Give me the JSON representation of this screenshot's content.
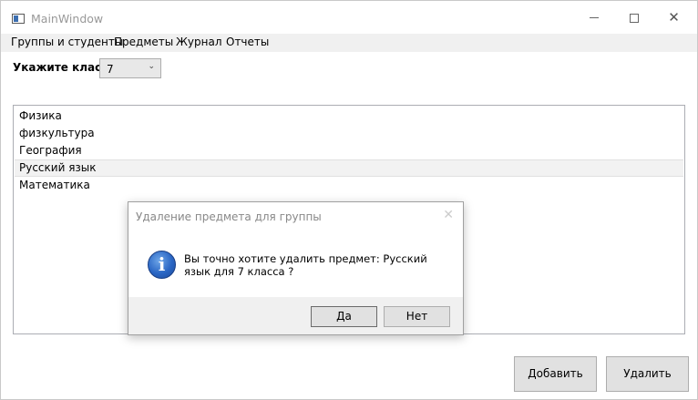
{
  "window": {
    "title": "MainWindow"
  },
  "menu": {
    "items": [
      "Группы и студенты",
      "Предметы",
      "Журнал",
      "Отчеты"
    ]
  },
  "class_picker": {
    "label": "Укажите класс:",
    "value": "7"
  },
  "subjects": {
    "items": [
      "Физика",
      "физкультура",
      "География",
      "Русский язык",
      "Математика"
    ],
    "selected": "Русский язык"
  },
  "buttons": {
    "add": "Добавить",
    "delete": "Удалить"
  },
  "dialog": {
    "title": "Удаление предмета для группы",
    "message": "Вы точно хотите удалить предмет: Русский язык для 7 класса ?",
    "yes": "Да",
    "no": "Нет",
    "icon": "info-icon"
  }
}
